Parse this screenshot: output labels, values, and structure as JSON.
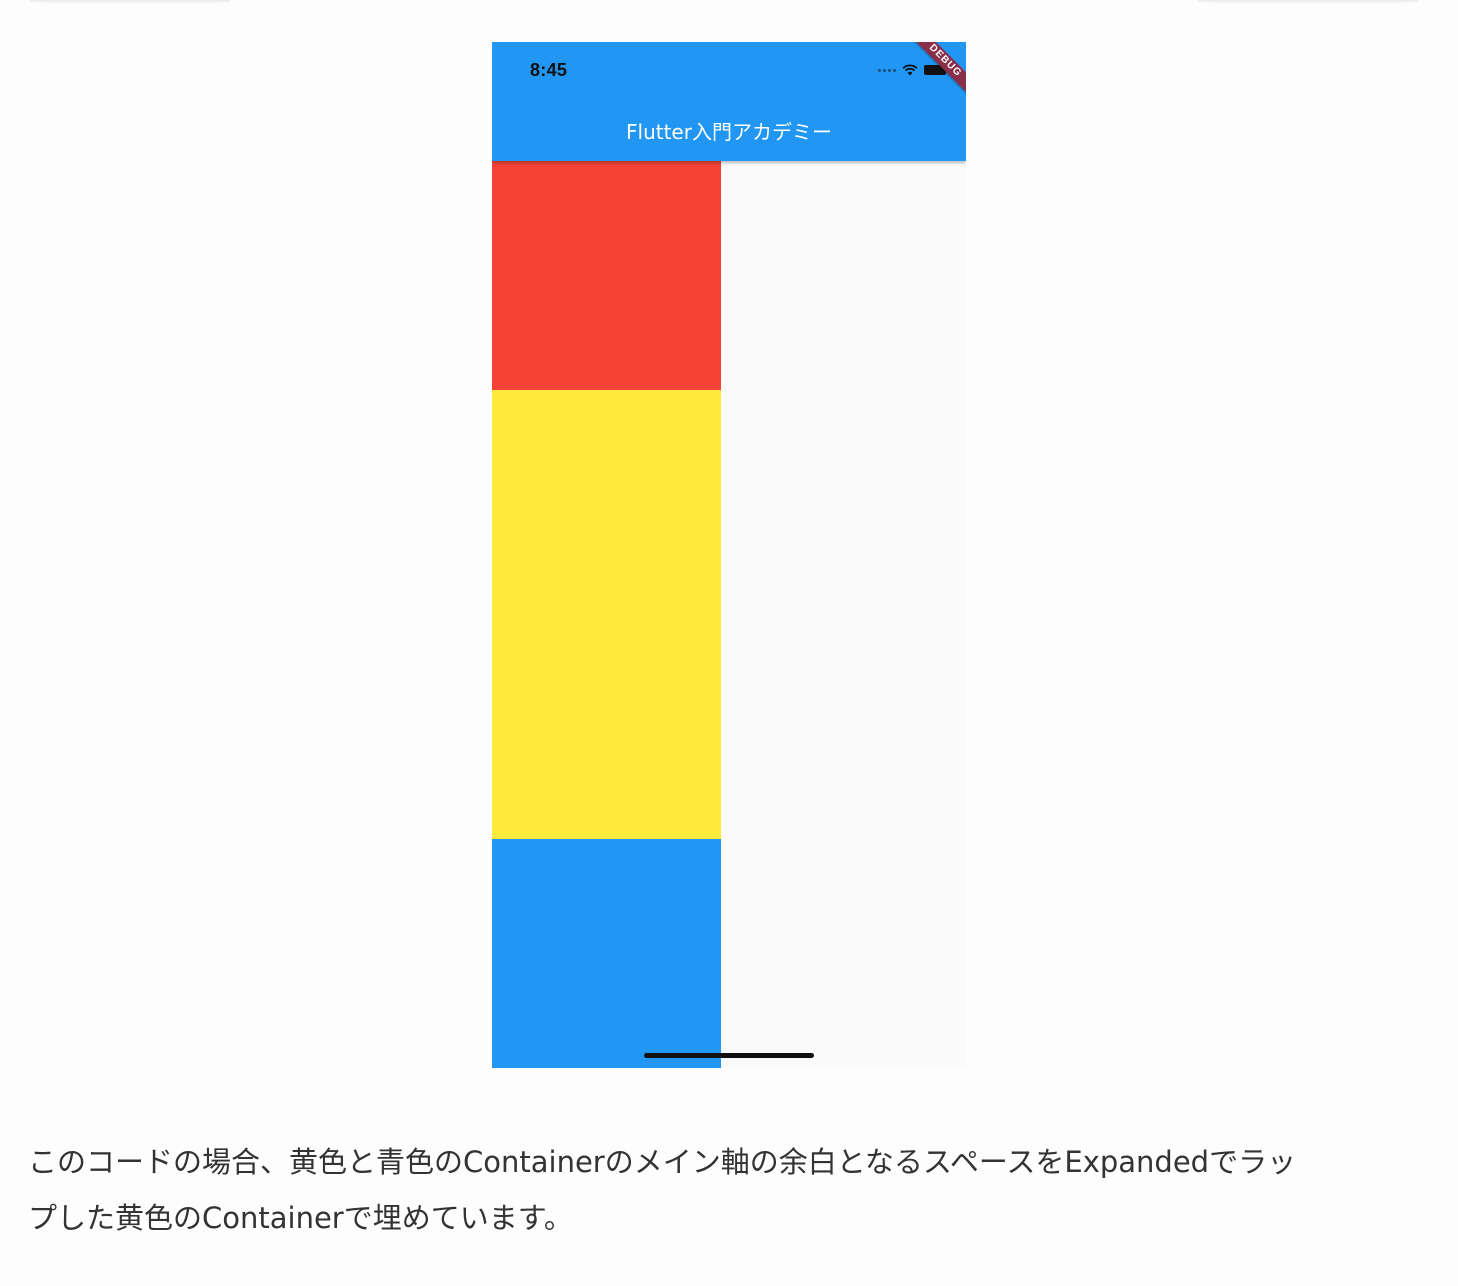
{
  "phone": {
    "status_bar": {
      "time": "8:45",
      "icons": [
        "signal-icon",
        "wifi-icon",
        "battery-icon"
      ]
    },
    "app_bar": {
      "title": "Flutter入門アカデミー",
      "color": "#2196f3"
    },
    "debug_banner": "DEBUG",
    "containers": [
      {
        "name": "red-container",
        "color": "#f44336"
      },
      {
        "name": "yellow-container",
        "color": "#ffeb3b"
      },
      {
        "name": "blue-container",
        "color": "#2196f3"
      }
    ]
  },
  "caption": {
    "line1": "このコードの場合、黄色と青色のContainerのメイン軸の余白となるスペースをExpandedでラッ",
    "line2": "プした黄色のContainerで埋めています。"
  }
}
